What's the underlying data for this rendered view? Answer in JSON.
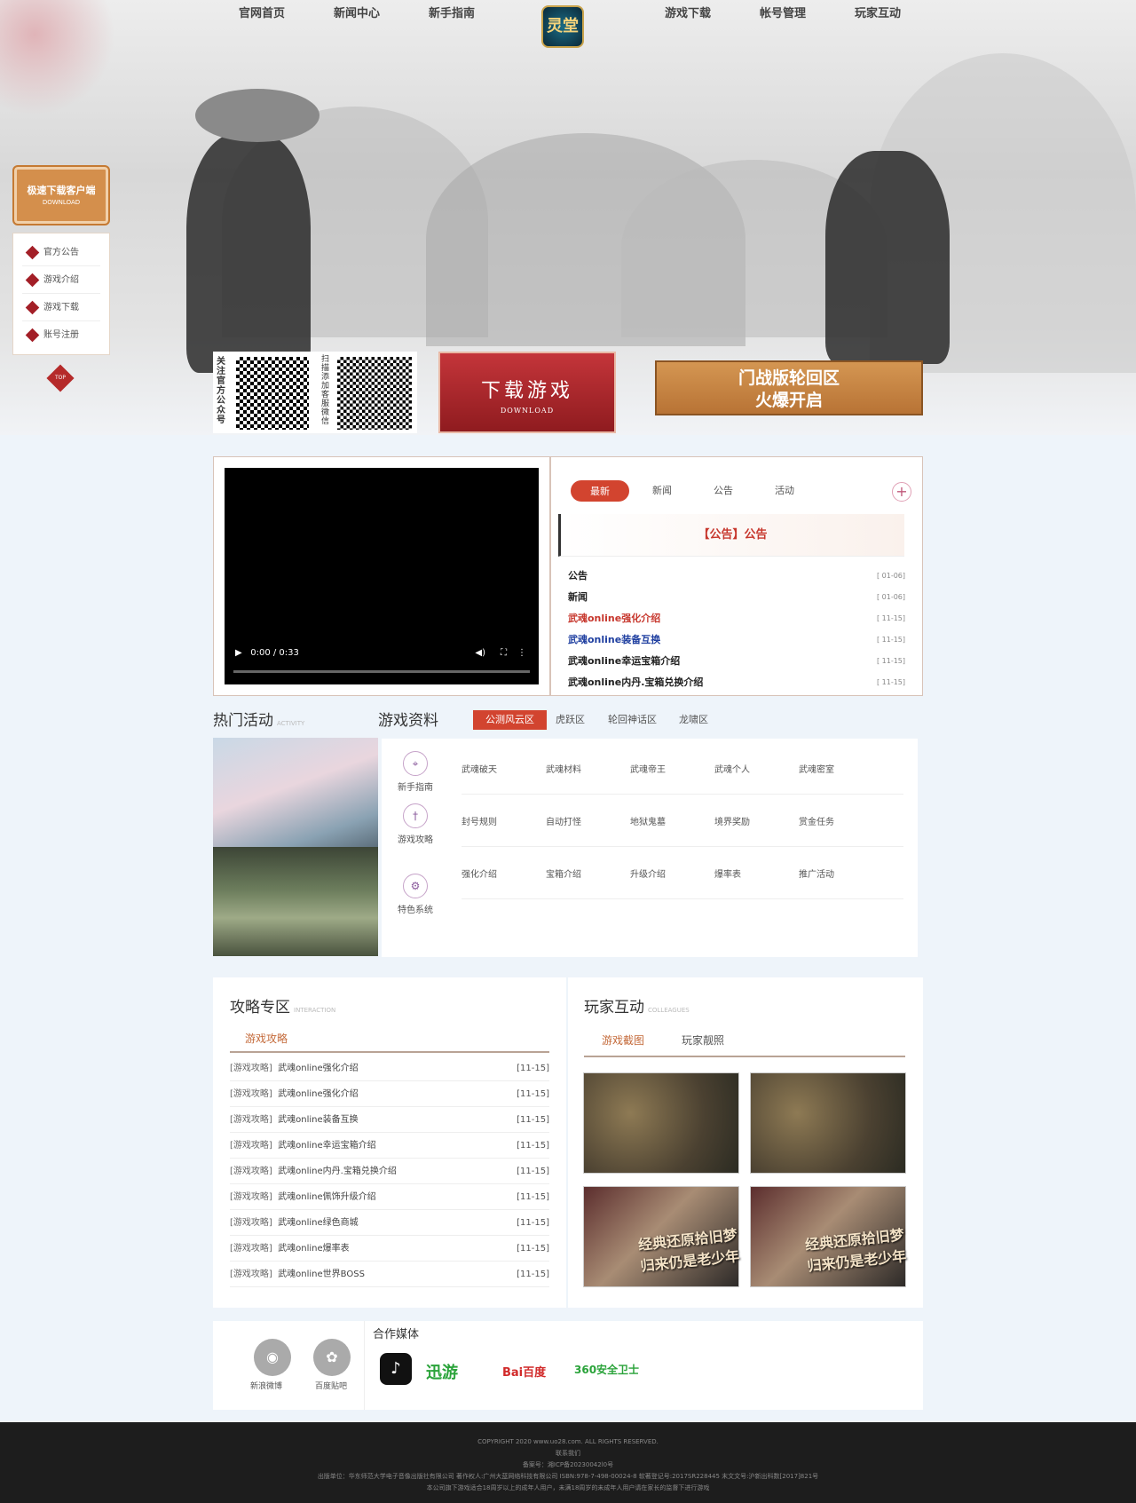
{
  "nav": {
    "left": [
      "官网首页",
      "新闻中心",
      "新手指南"
    ],
    "right": [
      "游戏下载",
      "帐号管理",
      "玩家互动"
    ],
    "logo": "灵堂"
  },
  "sidebar": {
    "download_label": "极速下载客户端",
    "download_sub": "DOWNLOAD",
    "items": [
      "官方公告",
      "游戏介绍",
      "游戏下载",
      "账号注册"
    ],
    "top": "TOP"
  },
  "qr": {
    "caption1": "关注官方公众号",
    "caption2": "扫描添加客服微信"
  },
  "download": {
    "label": "下载游戏",
    "sub": "DOWNLOAD"
  },
  "banner": {
    "line1": "门战版轮回区",
    "line2": "火爆开启"
  },
  "video": {
    "time": "0:00 / 0:33"
  },
  "news": {
    "tabs": [
      "最新",
      "新闻",
      "公告",
      "活动"
    ],
    "headline": "【公告】公告",
    "items": [
      {
        "t": "公告",
        "d": "[ 01-06]",
        "c": "#222"
      },
      {
        "t": "新闻",
        "d": "[ 01-06]",
        "c": "#222"
      },
      {
        "t": "武魂online强化介绍",
        "d": "[ 11-15]",
        "c": "#c7372d"
      },
      {
        "t": "武魂online装备互换",
        "d": "[ 11-15]",
        "c": "#1f3fa0"
      },
      {
        "t": "武魂online幸运宝箱介绍",
        "d": "[ 11-15]",
        "c": "#222"
      },
      {
        "t": "武魂online内丹.宝箱兑换介绍",
        "d": "[ 11-15]",
        "c": "#222"
      }
    ]
  },
  "hot": {
    "title": "热门活动",
    "sub": "ACTIVITY"
  },
  "gameinfo": {
    "title": "游戏资料",
    "tabs": [
      "公测风云区",
      "虎跃区",
      "轮回神话区",
      "龙啸区"
    ],
    "cats": [
      "新手指南",
      "游戏攻略",
      "特色系统"
    ],
    "rows": [
      [
        "武魂破天",
        "武魂材料",
        "武魂帝王",
        "武魂个人",
        "武魂密室"
      ],
      [
        "封号规则",
        "自动打怪",
        "地狱鬼墓",
        "境界奖励",
        "赏金任务"
      ],
      [
        "强化介绍",
        "宝箱介绍",
        "升级介绍",
        "爆率表",
        "推广活动"
      ]
    ]
  },
  "guide": {
    "title": "攻略专区",
    "sub": "INTERACTION",
    "tab": "游戏攻略",
    "items": [
      {
        "c": "[游戏攻略]",
        "t": "武魂online强化介绍",
        "d": "[11-15]"
      },
      {
        "c": "[游戏攻略]",
        "t": "武魂online强化介绍",
        "d": "[11-15]"
      },
      {
        "c": "[游戏攻略]",
        "t": "武魂online装备互换",
        "d": "[11-15]"
      },
      {
        "c": "[游戏攻略]",
        "t": "武魂online幸运宝箱介绍",
        "d": "[11-15]"
      },
      {
        "c": "[游戏攻略]",
        "t": "武魂online内丹.宝箱兑换介绍",
        "d": "[11-15]"
      },
      {
        "c": "[游戏攻略]",
        "t": "武魂online佩饰升级介绍",
        "d": "[11-15]"
      },
      {
        "c": "[游戏攻略]",
        "t": "武魂online绿色商城",
        "d": "[11-15]"
      },
      {
        "c": "[游戏攻略]",
        "t": "武魂online爆率表",
        "d": "[11-15]"
      },
      {
        "c": "[游戏攻略]",
        "t": "武魂online世界BOSS",
        "d": "[11-15]"
      }
    ]
  },
  "players": {
    "title": "玩家互动",
    "sub": "COLLEAGUES",
    "tabs": [
      "游戏截图",
      "玩家靓照"
    ],
    "shot_text": "经典还原拾旧梦 归来仍是老少年"
  },
  "media": {
    "title": "合作媒体",
    "social": [
      "新浪微博",
      "百度贴吧"
    ],
    "partners": [
      "迅游",
      "Bai百度",
      "360安全卫士"
    ]
  },
  "footer": {
    "lines": [
      "COPYRIGHT 2020 www.uo28.com. ALL RIGHTS RESERVED.",
      "联系我们",
      "备案号：湘ICP备20230042l0号",
      "出版单位：华东师范大学电子音像出版社有限公司 著作权人:广州大蓝网络科技有限公司 ISBN:978-7-498-00024-8 软著登记号:2017SR228445 末文文号:沪新出科数[2017]821号",
      "本公司旗下游戏适合18周岁以上的成年人用户，未满18周岁的未成年人用户请在家长的监督下进行游戏"
    ]
  }
}
